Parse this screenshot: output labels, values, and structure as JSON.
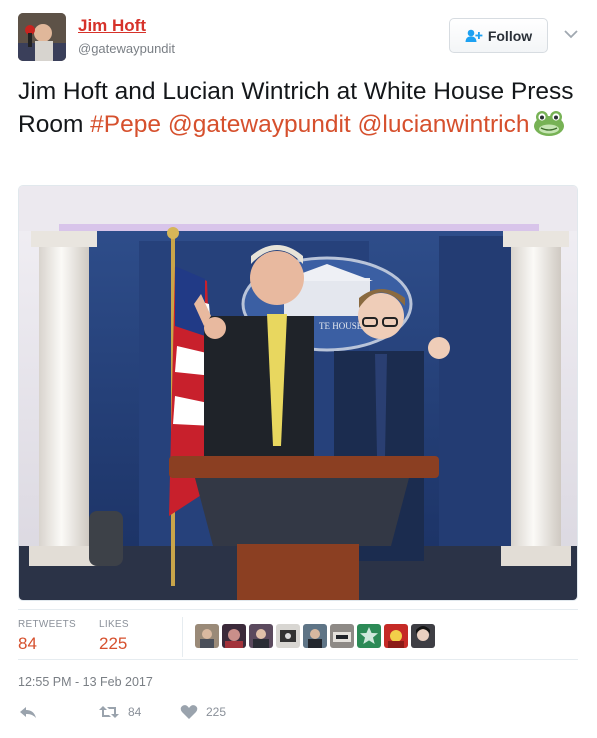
{
  "user": {
    "name": "Jim Hoft",
    "handle": "@gatewaypundit"
  },
  "follow": {
    "label": "Follow"
  },
  "tweet": {
    "text_plain": "Jim Hoft and Lucian Wintrich at White House Press Room ",
    "hashtag": "#Pepe",
    "mention1": "@gatewaypundit",
    "mention2": "@lucianwintrich",
    "emoji": "frog-face-icon"
  },
  "photo": {
    "seal_text": "TE HOUSE"
  },
  "stats": {
    "retweets_label": "RETWEETS",
    "retweets": "84",
    "likes_label": "LIKES",
    "likes": "225"
  },
  "likers": [
    "liker-avatar-1",
    "liker-avatar-2",
    "liker-avatar-3",
    "liker-avatar-4",
    "liker-avatar-5",
    "liker-avatar-6",
    "liker-avatar-7",
    "liker-avatar-8",
    "liker-avatar-9"
  ],
  "timestamp": "12:55 PM - 13 Feb 2017",
  "actions": {
    "retweet_count": "84",
    "like_count": "225"
  },
  "colors": {
    "accent": "#d6502d",
    "name": "#d6322a",
    "muted": "#8a9099"
  }
}
